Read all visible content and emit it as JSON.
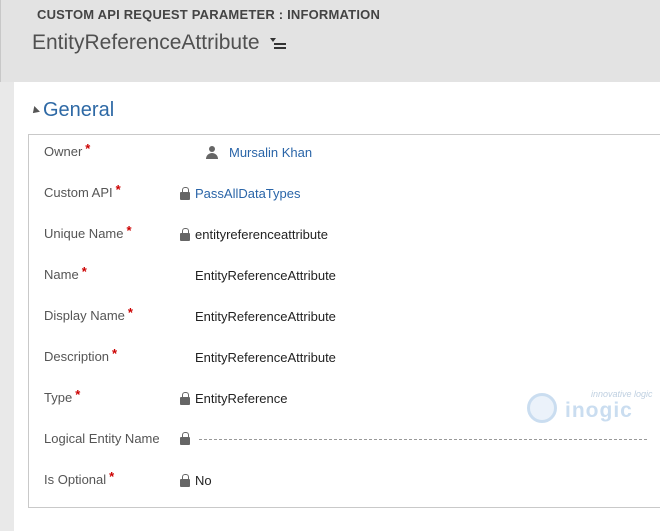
{
  "header": {
    "entity_type": "CUSTOM API REQUEST PARAMETER : INFORMATION",
    "record_title": "EntityReferenceAttribute"
  },
  "section": {
    "title": "General"
  },
  "fields": [
    {
      "label": "Owner",
      "required": "*",
      "value": "Mursalin Khan"
    },
    {
      "label": "Custom API",
      "required": "*",
      "value": "PassAllDataTypes"
    },
    {
      "label": "Unique Name",
      "required": "*",
      "value": "entityreferenceattribute"
    },
    {
      "label": "Name",
      "required": "*",
      "value": "EntityReferenceAttribute"
    },
    {
      "label": "Display Name",
      "required": "*",
      "value": "EntityReferenceAttribute"
    },
    {
      "label": "Description",
      "required": "*",
      "value": "EntityReferenceAttribute"
    },
    {
      "label": "Type",
      "required": "*",
      "value": "EntityReference"
    },
    {
      "label": "Logical Entity Name",
      "required": "",
      "value": ""
    },
    {
      "label": "Is Optional",
      "required": "*",
      "value": "No"
    }
  ],
  "watermark": {
    "tagline": "innovative logic",
    "brand": "inogic"
  },
  "colors": {
    "link": "#2a65a8",
    "section_title": "#2e69a5",
    "required": "#cc0000"
  }
}
